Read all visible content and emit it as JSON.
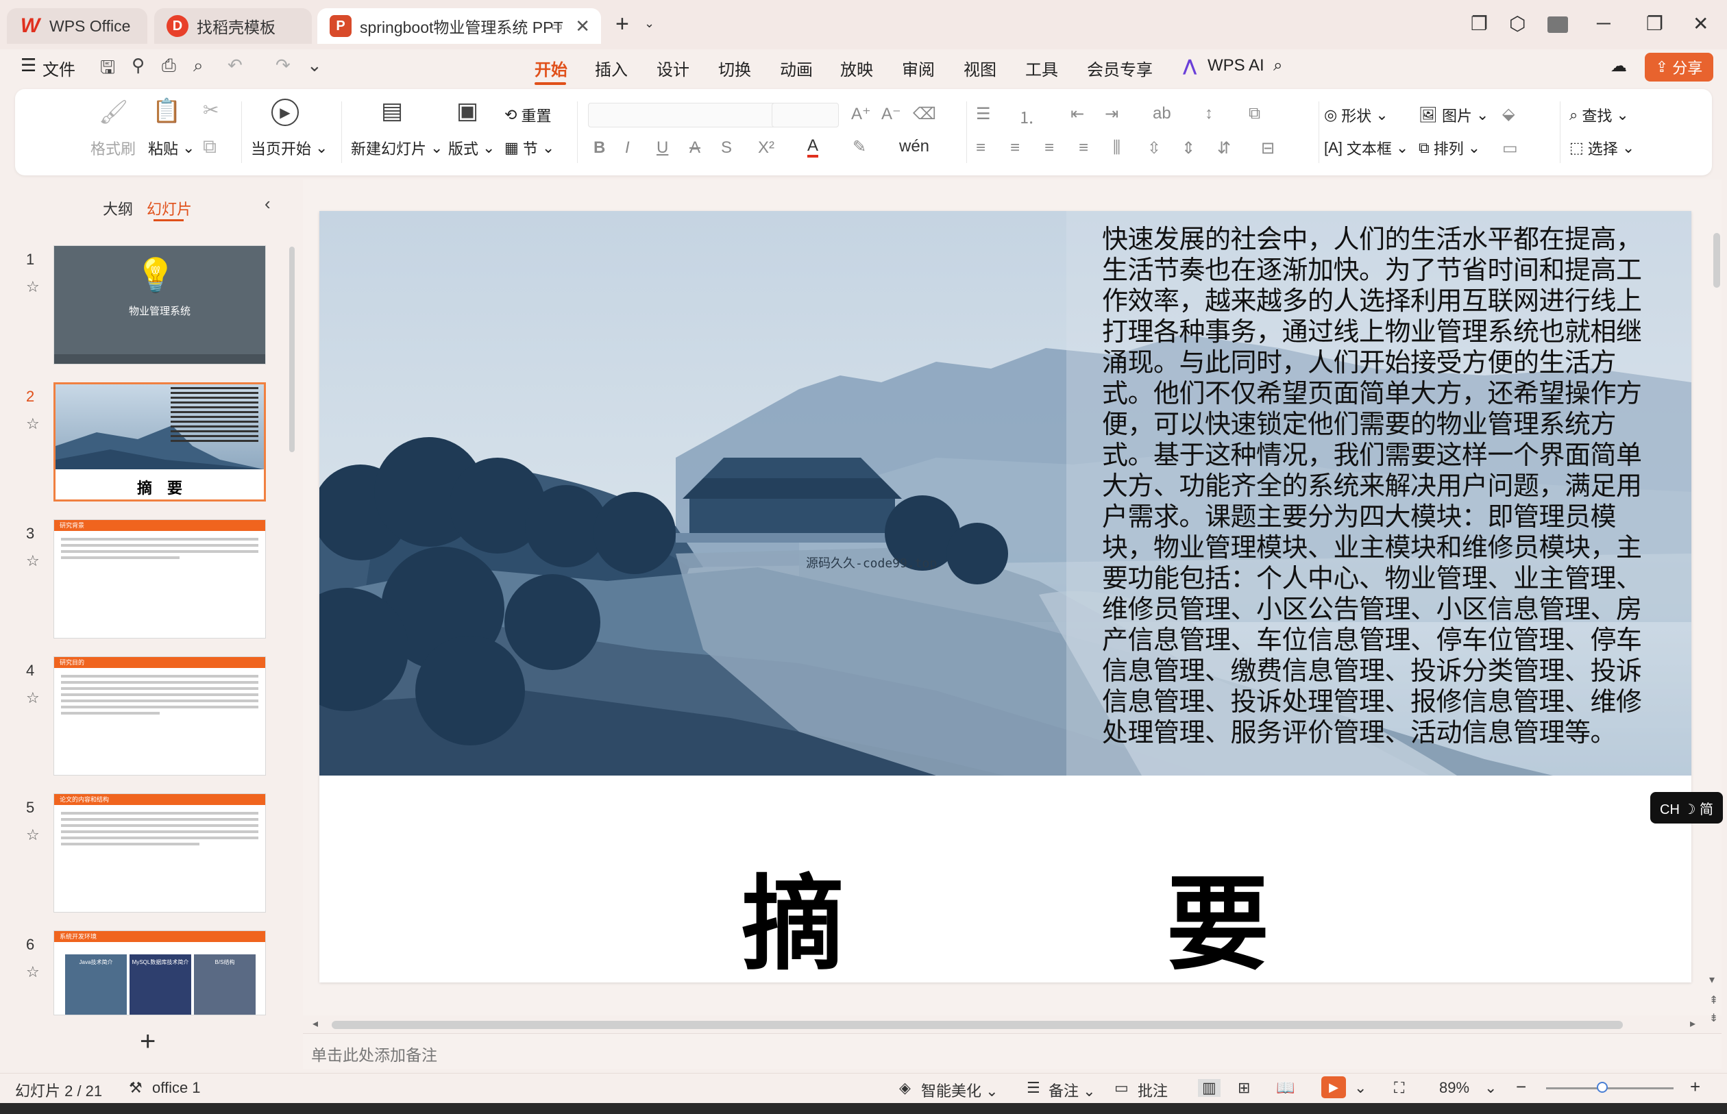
{
  "window": {
    "tabs": [
      {
        "label": "WPS Office"
      },
      {
        "label": "找稻壳模板"
      },
      {
        "label": "springboot物业管理系统 PPT"
      }
    ]
  },
  "menu": {
    "file": "文件",
    "items": [
      "开始",
      "插入",
      "设计",
      "切换",
      "动画",
      "放映",
      "审阅",
      "视图",
      "工具",
      "会员专享"
    ],
    "active": "开始",
    "wps_ai": "WPS AI",
    "share": "分享"
  },
  "ribbon": {
    "format_painter": "格式刷",
    "paste": "粘贴",
    "from_current": "当页开始",
    "new_slide": "新建幻灯片",
    "layout": "版式",
    "reset": "重置",
    "section": "节",
    "shape": "形状",
    "picture": "图片",
    "find": "查找",
    "textbox": "文本框",
    "arrange": "排列",
    "select": "选择"
  },
  "left_panel": {
    "outline_tab": "大纲",
    "slides_tab": "幻灯片",
    "slides": [
      {
        "num": "1",
        "title": "物业管理系统"
      },
      {
        "num": "2",
        "title": "摘　要"
      },
      {
        "num": "3",
        "header": "研究背景"
      },
      {
        "num": "4",
        "header": "研究目的"
      },
      {
        "num": "5",
        "header": "论文的内容和结构"
      },
      {
        "num": "6",
        "header": "系统开发环境",
        "cards": [
          "Java技术简介",
          "MySQL数据库技术简介",
          "B/S结构"
        ]
      }
    ]
  },
  "slide": {
    "abstract": "快速发展的社会中，人们的生活水平都在提高，生活节奏也在逐渐加快。为了节省时间和提高工作效率，越来越多的人选择利用互联网进行线上打理各种事务，通过线上物业管理系统也就相继涌现。与此同时，人们开始接受方便的生活方式。他们不仅希望页面简单大方，还希望操作方便，可以快速锁定他们需要的物业管理系统方式。基于这种情况，我们需要这样一个界面简单大方、功能齐全的系统来解决用户问题，满足用户需求。课题主要分为四大模块：即管理员模块，物业管理模块、业主模块和维修员模块，主要功能包括：个人中心、物业管理、业主管理、维修员管理、小区公告管理、小区信息管理、房产信息管理、车位信息管理、停车位管理、停车信息管理、缴费信息管理、投诉分类管理、投诉信息管理、投诉处理管理、报修信息管理、维修处理管理、服务评价管理、活动信息管理等。",
    "watermark": "源码久久-code99.top",
    "title": "摘　要"
  },
  "ime": "CH ☽ 简",
  "notes_placeholder": "单击此处添加备注",
  "status": {
    "slide_info": "幻灯片 2 / 21",
    "theme": "office 1",
    "beautify": "智能美化",
    "notes": "备注",
    "comment": "批注",
    "zoom": "89%"
  },
  "colors": {
    "accent": "#e0501a",
    "share_bg": "#e8632e",
    "thumb_header": "#f0641e"
  }
}
